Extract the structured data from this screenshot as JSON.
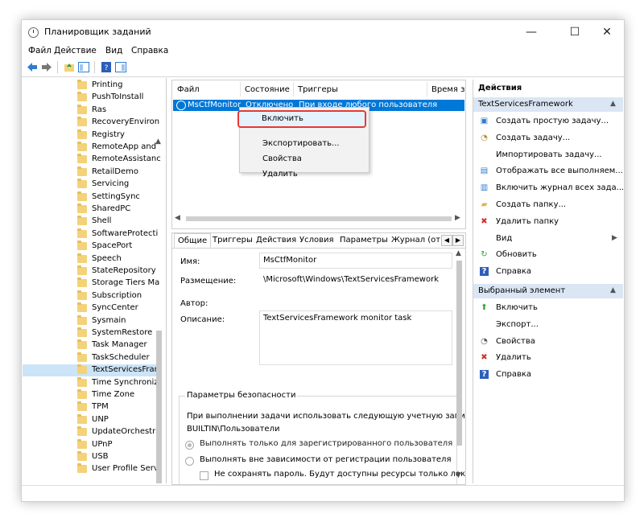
{
  "window": {
    "title": "Планировщик заданий",
    "minimize": "—",
    "maximize": "☐",
    "close": "✕"
  },
  "menu": [
    "Файл",
    "Действие",
    "Вид",
    "Справка"
  ],
  "tree": {
    "items": [
      "Printing",
      "PushToInstall",
      "Ras",
      "RecoveryEnviron",
      "Registry",
      "RemoteApp and",
      "RemoteAssistanc",
      "RetailDemo",
      "Servicing",
      "SettingSync",
      "SharedPC",
      "Shell",
      "SoftwareProtecti",
      "SpacePort",
      "Speech",
      "StateRepository",
      "Storage Tiers Ma",
      "Subscription",
      "SyncCenter",
      "Sysmain",
      "SystemRestore",
      "Task Manager",
      "TaskScheduler",
      "TextServicesFram",
      "Time Synchroniz",
      "Time Zone",
      "TPM",
      "UNP",
      "UpdateOrchestra",
      "UPnP",
      "USB",
      "User Profile Servi"
    ],
    "selected_index": 23
  },
  "tasklist": {
    "columns": [
      "Файл",
      "Состояние",
      "Триггеры",
      "Время з"
    ],
    "row": {
      "name": "MsCtfMonitor",
      "state": "Отключено",
      "trigger": "При входе любого пользователя"
    }
  },
  "context_menu": {
    "items": [
      "Включить",
      "Экспортировать...",
      "Свойства",
      "Удалить"
    ]
  },
  "details": {
    "tabs": [
      "Общие",
      "Триггеры",
      "Действия",
      "Условия",
      "Параметры",
      "Журнал (отк"
    ],
    "fields": {
      "name_label": "Имя:",
      "name_value": "MsCtfMonitor",
      "location_label": "Размещение:",
      "location_value": "\\Microsoft\\Windows\\TextServicesFramework",
      "author_label": "Автор:",
      "description_label": "Описание:",
      "description_value": "TextServicesFramework monitor task"
    },
    "security": {
      "legend": "Параметры безопасности",
      "account_text": "При выполнении задачи использовать следующую учетную запись п",
      "account_value": "BUILTIN\\Пользователи",
      "radio1": "Выполнять только для зарегистрированного пользователя",
      "radio2": "Выполнять вне зависимости от регистрации пользователя",
      "checkbox": "Не сохранять пароль. Будут доступны ресурсы только локальн"
    }
  },
  "actions": {
    "header": "Действия",
    "section1": "TextServicesFramework",
    "items1": [
      {
        "icon": "create-basic-task-icon",
        "label": "Создать простую задачу..."
      },
      {
        "icon": "create-task-icon",
        "label": "Создать задачу..."
      },
      {
        "icon": "",
        "label": "Импортировать задачу..."
      },
      {
        "icon": "show-running-icon",
        "label": "Отображать все выполняем..."
      },
      {
        "icon": "enable-log-icon",
        "label": "Включить журнал всех зада..."
      },
      {
        "icon": "new-folder-icon",
        "label": "Создать папку..."
      },
      {
        "icon": "delete-folder-icon",
        "label": "Удалить папку"
      },
      {
        "icon": "",
        "label": "Вид"
      },
      {
        "icon": "refresh-icon",
        "label": "Обновить"
      },
      {
        "icon": "help-icon",
        "label": "Справка"
      }
    ],
    "section2": "Выбранный элемент",
    "items2": [
      {
        "icon": "enable-icon",
        "label": "Включить"
      },
      {
        "icon": "",
        "label": "Экспорт..."
      },
      {
        "icon": "properties-icon",
        "label": "Свойства"
      },
      {
        "icon": "delete-icon",
        "label": "Удалить"
      },
      {
        "icon": "help-icon",
        "label": "Справка"
      }
    ]
  }
}
